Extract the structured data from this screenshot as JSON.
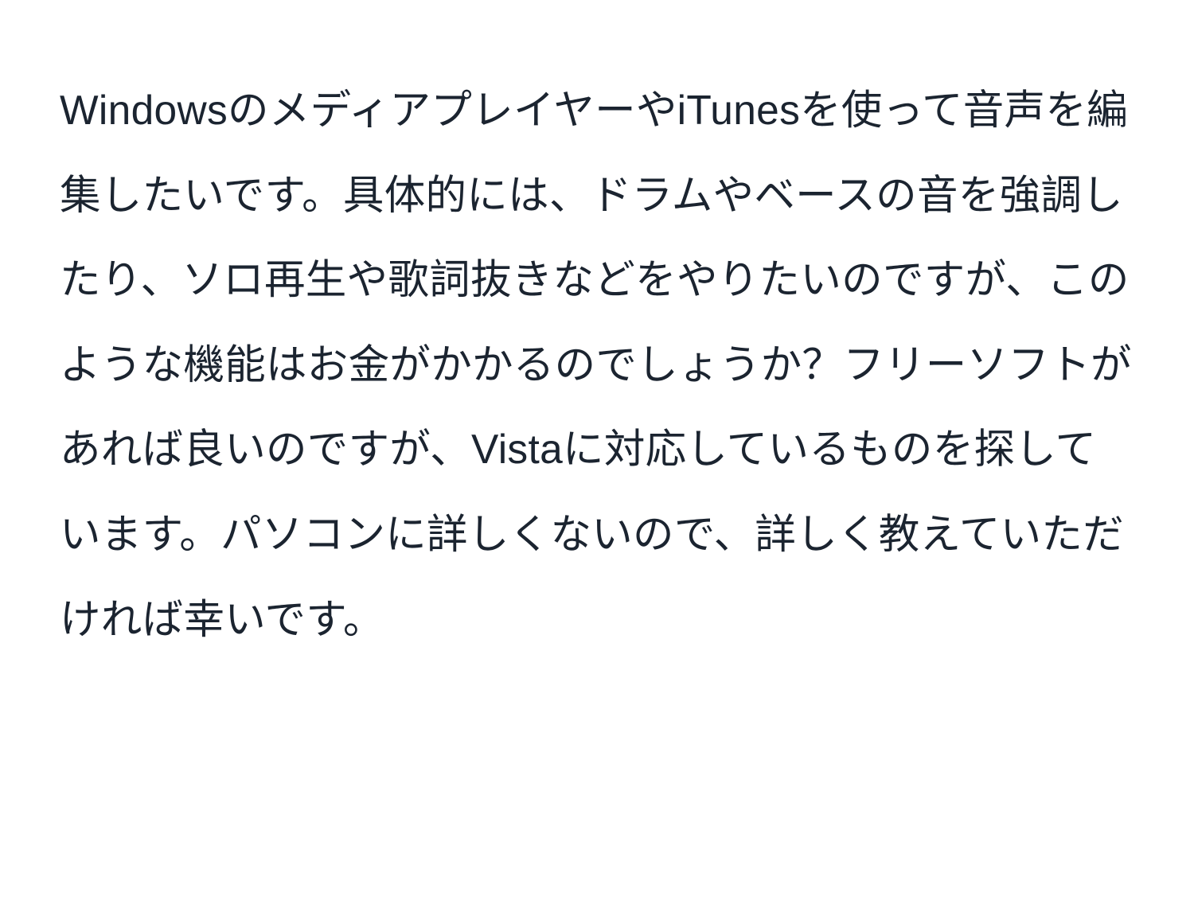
{
  "body_text": "WindowsのメディアプレイヤーやiTunesを使って音声を編集したいです。具体的には、ドラムやベースの音を強調したり、ソロ再生や歌詞抜きなどをやりたいのですが、このような機能はお金がかかるのでしょうか？フリーソフトがあれば良いのですが、Vistaに対応しているものを探しています。パソコンに詳しくないので、詳しく教えていただければ幸いです。"
}
